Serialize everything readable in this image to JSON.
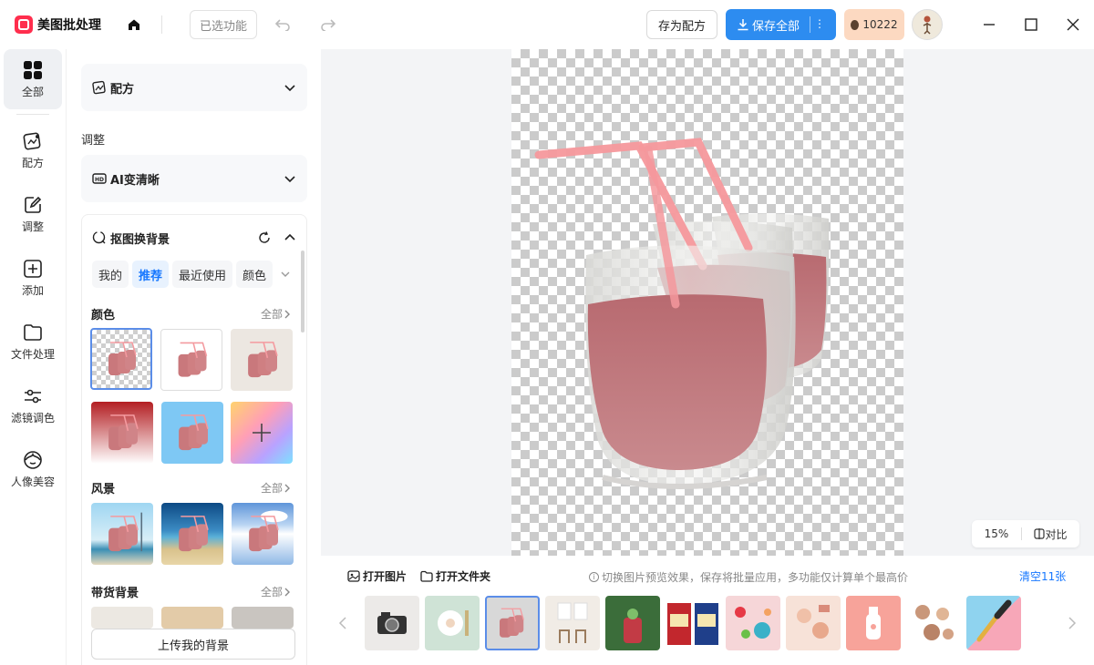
{
  "app": {
    "title": "美图批处理",
    "selected_features": "已选功能",
    "save_recipe": "存为配方",
    "save_all": "保存全部",
    "coins": "10222",
    "brand_color": "#ff2e4d",
    "accent_color": "#2d8cf0"
  },
  "nav": [
    {
      "label": "全部",
      "icon": "grid-icon",
      "active": true
    },
    {
      "label": "配方",
      "icon": "recipe-icon"
    },
    {
      "label": "调整",
      "icon": "edit-icon"
    },
    {
      "label": "添加",
      "icon": "add-icon"
    },
    {
      "label": "文件处理",
      "icon": "folder-icon"
    },
    {
      "label": "滤镜调色",
      "icon": "sliders-icon"
    },
    {
      "label": "人像美容",
      "icon": "face-icon"
    }
  ],
  "panel": {
    "recipe_card": "配方",
    "adjust_label": "调整",
    "ai_card": "AI变清晰",
    "matting": {
      "title": "抠图换背景",
      "tabs": [
        "我的",
        "推荐",
        "最近使用",
        "颜色"
      ],
      "active_tab": "推荐",
      "categories": [
        {
          "title": "颜色",
          "all": "全部"
        },
        {
          "title": "风景",
          "all": "全部"
        },
        {
          "title": "带货背景",
          "all": "全部"
        }
      ],
      "upload": "上传我的背景"
    }
  },
  "canvas": {
    "zoom": "15%",
    "compare": "对比"
  },
  "bottom": {
    "open_image": "打开图片",
    "open_folder": "打开文件夹",
    "hint": "切换图片预览效果，保存将批量应用，多功能仅计算单个最高价",
    "clear": "清空11张"
  }
}
